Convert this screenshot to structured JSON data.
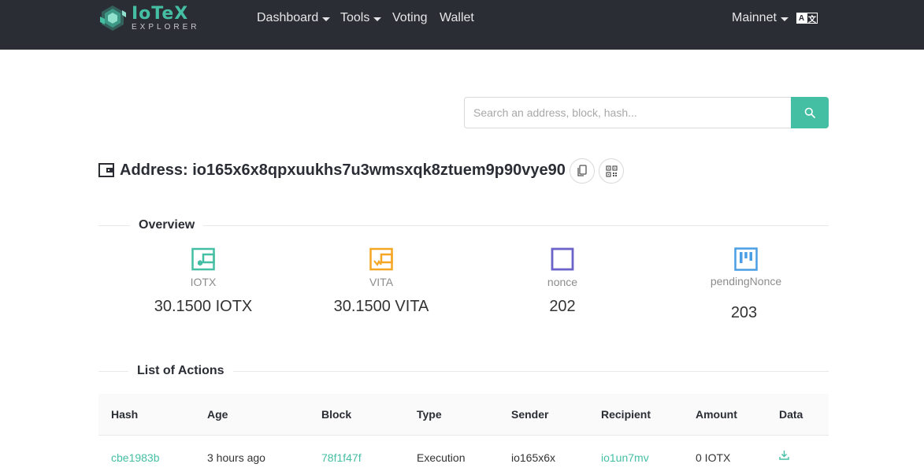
{
  "brand": {
    "name": "IoTeX",
    "sub": "EXPLORER",
    "color": "#44bfa3"
  },
  "nav": {
    "items": [
      {
        "label": "Dashboard",
        "dropdown": true
      },
      {
        "label": "Tools",
        "dropdown": true
      },
      {
        "label": "Voting",
        "dropdown": false
      },
      {
        "label": "Wallet",
        "dropdown": false
      }
    ],
    "network": "Mainnet",
    "language_icon": "translate-icon",
    "background": "#2b2d35"
  },
  "search": {
    "placeholder": "Search an address, block, hash...",
    "value": "",
    "icon": "search-icon"
  },
  "address": {
    "title": "Address: io165x6x8qpxuukhs7u3wmsxqk8ztuem9p90vye90",
    "copy_icon": "copy-icon",
    "qr_icon": "qr-code-icon"
  },
  "overview": {
    "title": "Overview",
    "stats": [
      {
        "label": "IOTX",
        "value": "30.1500 IOTX",
        "icon": "wallet-iotx-icon",
        "color": "#44bfa3"
      },
      {
        "label": "VITA",
        "value": "30.1500 VITA",
        "icon": "wallet-vita-icon",
        "color": "#f5a623"
      },
      {
        "label": "nonce",
        "value": "202",
        "icon": "square-icon",
        "color": "#6b63c8"
      },
      {
        "label": "pendingNonce",
        "value": "203",
        "icon": "kanban-icon",
        "color": "#4a9ee3"
      }
    ]
  },
  "actions": {
    "title": "List of Actions",
    "columns": [
      "Hash",
      "Age",
      "Block",
      "Type",
      "Sender",
      "Recipient",
      "Amount",
      "Data"
    ],
    "rows": [
      {
        "hash": "cbe1983b",
        "age": "3 hours ago",
        "block": "78f1f47f",
        "type": "Execution",
        "sender": "io165x6x",
        "recipient": "io1un7mv",
        "amount": "0 IOTX",
        "data_icon": "download-icon"
      }
    ]
  }
}
